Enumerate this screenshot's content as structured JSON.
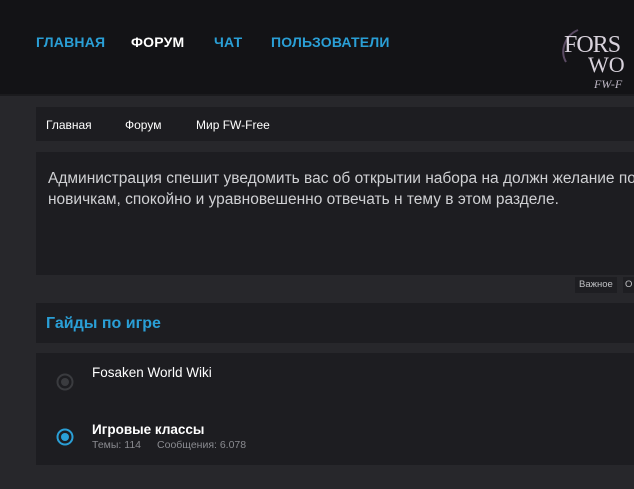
{
  "nav": {
    "items": [
      {
        "label": "ГЛАВНАЯ"
      },
      {
        "label": "ФОРУМ"
      },
      {
        "label": "ЧАТ"
      },
      {
        "label": "ПОЛЬЗОВАТЕЛИ"
      }
    ],
    "active_index": 1
  },
  "logo": {
    "text_line1": "FORS",
    "text_line2": "WO",
    "text_line3": "FW-F"
  },
  "breadcrumb": [
    "Главная",
    "Форум",
    "Мир FW-Free"
  ],
  "notice": {
    "text": "Администрация спешит уведомить вас об открытии набора на должн желание помогать новичкам, спокойно и уравновешенно отвечать н тему в этом разделе."
  },
  "tags": [
    "Важное",
    "О"
  ],
  "section": {
    "title": "Гайды по игре"
  },
  "forums": [
    {
      "title": "Fosaken World Wiki",
      "status": "read"
    },
    {
      "title": "Игровые классы",
      "status": "unread",
      "threads": "Темы: 114",
      "messages": "Сообщения: 6.078"
    }
  ],
  "colors": {
    "accent": "#2a9fd6",
    "background": "#27272b",
    "panel": "#1d1d21",
    "topbar": "#131316"
  }
}
